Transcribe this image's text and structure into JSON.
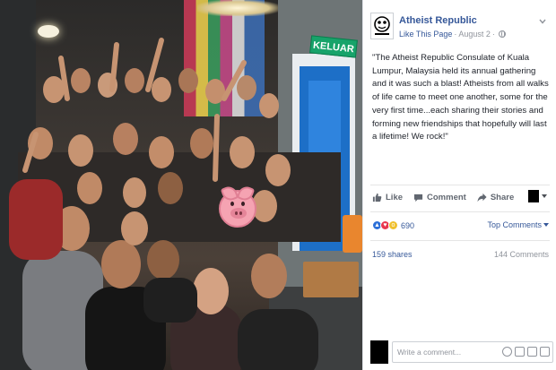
{
  "photo": {
    "sign_text": "KELUAR"
  },
  "post": {
    "page_name": "Atheist Republic",
    "like_page_label": "Like This Page",
    "separator": "·",
    "date": "August 2",
    "text": "\"The Atheist Republic Consulate of Kuala Lumpur, Malaysia held its annual gathering and it was such a blast! Atheists from all walks of life came to meet one another, some for the very first time...each sharing their stories and forming new friendships that hopefully will last a lifetime! We rock!\""
  },
  "actions": {
    "like_label": "Like",
    "comment_label": "Comment",
    "share_label": "Share"
  },
  "reactions": {
    "count": "690",
    "types": [
      "like-icon",
      "love-icon",
      "wow-icon"
    ]
  },
  "sort": {
    "label": "Top Comments"
  },
  "stats": {
    "shares": "159 shares",
    "comments": "144 Comments"
  },
  "composer": {
    "placeholder": "Write a comment..."
  },
  "colors": {
    "link": "#365899",
    "muted": "#90949c",
    "like_reaction": "#2c6fd8",
    "love_reaction": "#e8364f",
    "wow_reaction": "#f0c02d"
  }
}
